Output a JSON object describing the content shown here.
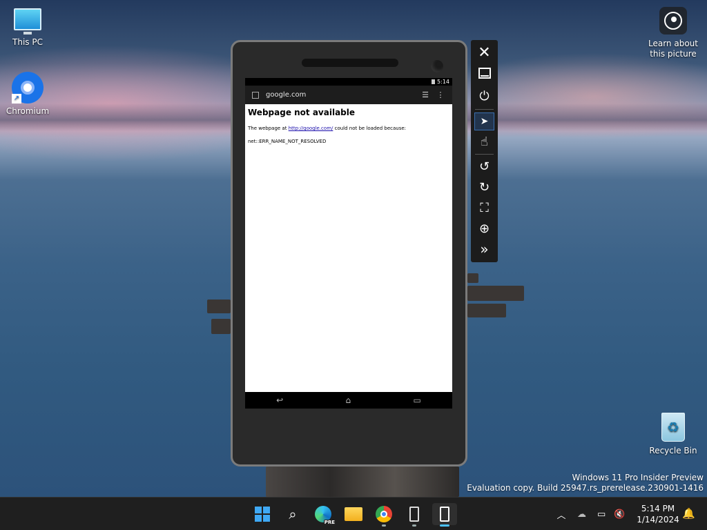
{
  "desktop": {
    "icons": [
      {
        "label": "This PC",
        "icon": "monitor-icon"
      },
      {
        "label": "Chromium",
        "icon": "chromium-icon"
      },
      {
        "label": "Recycle Bin",
        "icon": "recycle-bin-icon"
      }
    ],
    "learn_label": "Learn about this picture"
  },
  "emulator": {
    "status_time": "5:14",
    "url": "google.com",
    "error_title": "Webpage not available",
    "error_prefix": "The webpage at ",
    "error_link": "http://google.com/",
    "error_suffix": " could not be loaded because:",
    "error_code": "net::ERR_NAME_NOT_RESOLVED",
    "toolbar": [
      "close-icon",
      "minimize-icon",
      "power-icon",
      "pointer-icon",
      "touch-icon",
      "rotate-left-icon",
      "rotate-right-icon",
      "fit-screen-icon",
      "zoom-icon",
      "more-icon"
    ]
  },
  "watermark": {
    "line1": "Windows 11 Pro Insider Preview",
    "line2": "Evaluation copy. Build 25947.rs_prerelease.230901-1416"
  },
  "taskbar": {
    "pinned": [
      "start-icon",
      "search-icon",
      "edge-icon",
      "file-explorer-icon",
      "chrome-icon",
      "phone-emulator-icon",
      "emulator-icon"
    ],
    "time": "5:14 PM",
    "date": "1/14/2024"
  }
}
